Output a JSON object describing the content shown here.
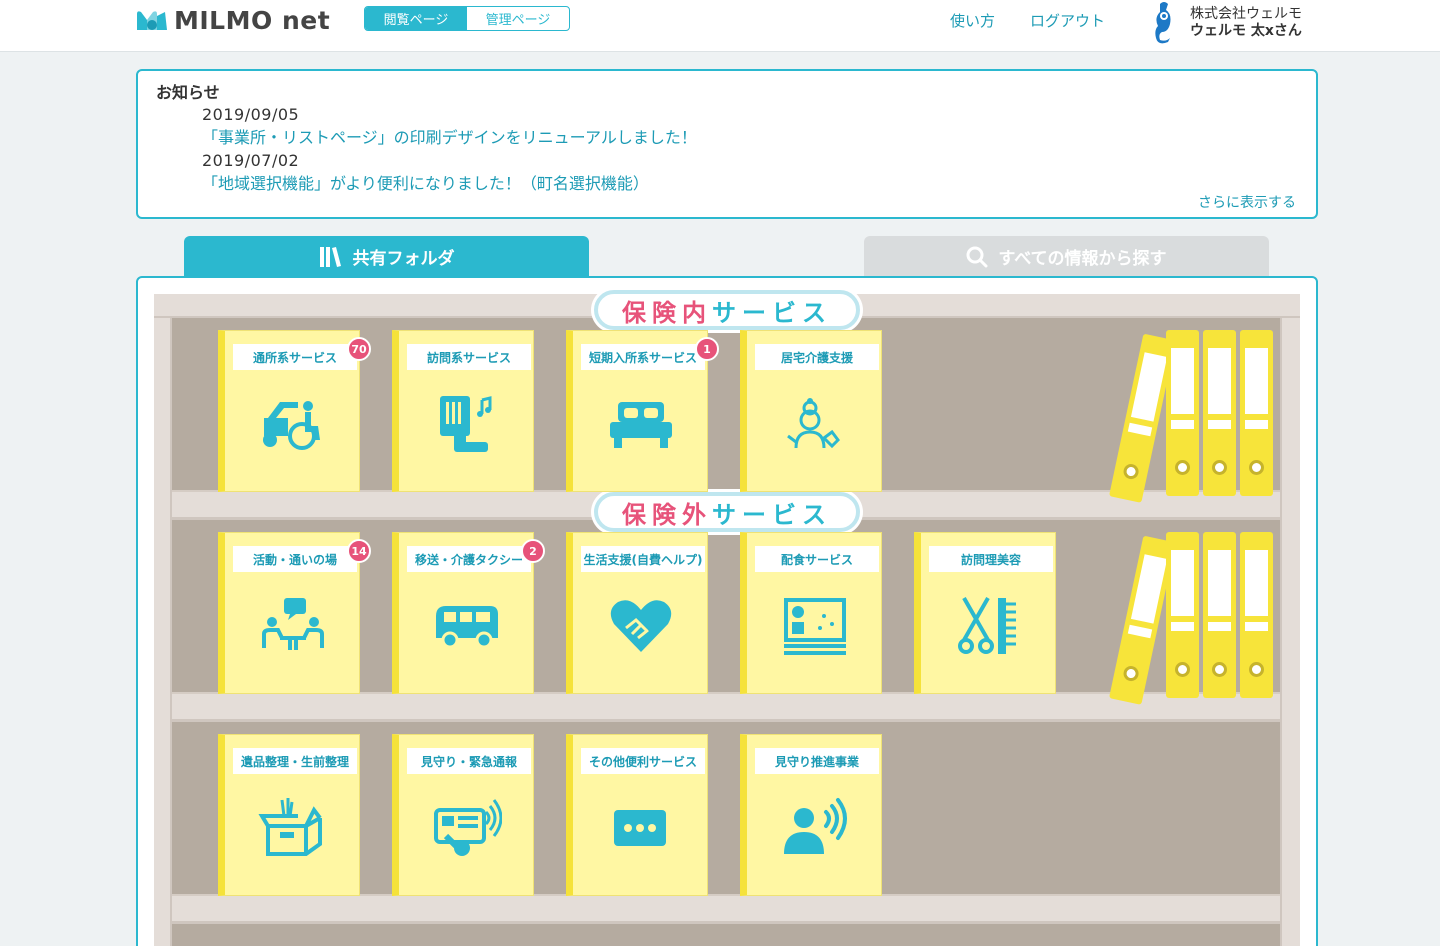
{
  "header": {
    "logo_text": "MILMO net",
    "mode_view": "閲覧ページ",
    "mode_admin": "管理ページ",
    "nav_help": "使い方",
    "nav_logout": "ログアウト",
    "user_company": "株式会社ウェルモ",
    "user_name": "ウェルモ 太xさん",
    "accent_color": "#2bb8cf"
  },
  "notice": {
    "title": "お知らせ",
    "items": [
      {
        "date": "2019/09/05",
        "text": "「事業所・リストページ」の印刷デザインをリニューアルしました！"
      },
      {
        "date": "2019/07/02",
        "text": "「地域選択機能」がより便利になりました！（町名選択機能）"
      }
    ],
    "more": "さらに表示する"
  },
  "tabs": {
    "shared": "共有フォルダ",
    "search": "すべての情報から探す"
  },
  "sections": {
    "insured": [
      "保",
      "険",
      "内",
      "サ",
      "ー",
      "ビ",
      "ス"
    ],
    "uninsured": [
      "保",
      "険",
      "外",
      "サ",
      "ー",
      "ビ",
      "ス"
    ]
  },
  "books": {
    "row1": [
      {
        "label": "通所系サービス",
        "badge": "70",
        "icon": "wheelchair-vehicle-icon"
      },
      {
        "label": "訪問系サービス",
        "badge": "",
        "icon": "doorbell-icon"
      },
      {
        "label": "短期入所系サービス",
        "badge": "1",
        "icon": "bed-icon"
      },
      {
        "label": "居宅介護支援",
        "badge": "",
        "icon": "care-worker-icon"
      }
    ],
    "row2": [
      {
        "label": "活動・通いの場",
        "badge": "14",
        "icon": "conversation-icon"
      },
      {
        "label": "移送・介護タクシー",
        "badge": "2",
        "icon": "van-icon"
      },
      {
        "label": "生活支援(自費ヘルプ)",
        "badge": "",
        "icon": "heart-handshake-icon"
      },
      {
        "label": "配食サービス",
        "badge": "",
        "icon": "meal-box-icon"
      },
      {
        "label": "訪問理美容",
        "badge": "",
        "icon": "scissors-comb-icon"
      }
    ],
    "row3": [
      {
        "label": "遺品整理・生前整理",
        "badge": "",
        "icon": "box-icon"
      },
      {
        "label": "見守り・緊急通報",
        "badge": "",
        "icon": "emergency-call-icon"
      },
      {
        "label": "その他便利サービス",
        "badge": "",
        "icon": "more-icon"
      },
      {
        "label": "見守り推進事業",
        "badge": "",
        "icon": "person-voice-icon"
      }
    ]
  }
}
